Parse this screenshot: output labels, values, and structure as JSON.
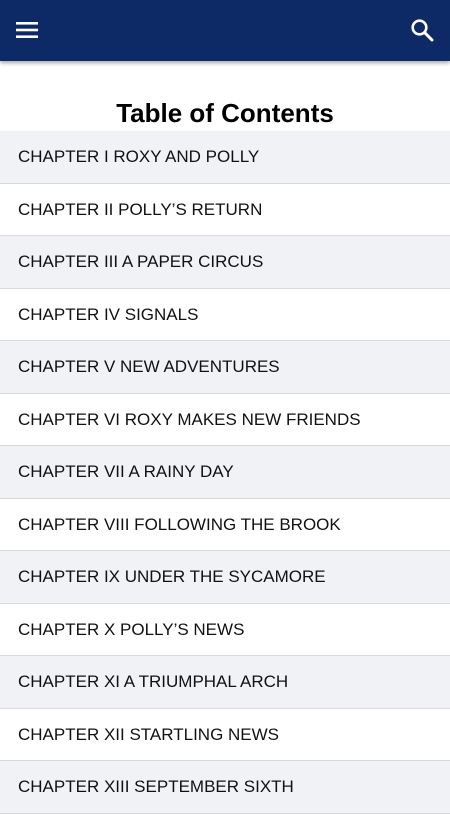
{
  "app_bar": {
    "menu_icon": "hamburger-menu-icon",
    "search_icon": "search-icon",
    "background_color": "#0d2a66"
  },
  "page": {
    "title": "Table of Contents"
  },
  "chapters": [
    {
      "label": "CHAPTER I ROXY AND POLLY"
    },
    {
      "label": "CHAPTER II POLLY’S RETURN"
    },
    {
      "label": "CHAPTER III A PAPER CIRCUS"
    },
    {
      "label": "CHAPTER IV SIGNALS"
    },
    {
      "label": "CHAPTER V NEW ADVENTURES"
    },
    {
      "label": "CHAPTER VI ROXY MAKES NEW FRIENDS"
    },
    {
      "label": "CHAPTER VII A RAINY DAY"
    },
    {
      "label": "CHAPTER VIII FOLLOWING THE BROOK"
    },
    {
      "label": "CHAPTER IX UNDER THE SYCAMORE"
    },
    {
      "label": "CHAPTER X POLLY’S NEWS"
    },
    {
      "label": "CHAPTER XI A TRIUMPHAL ARCH"
    },
    {
      "label": "CHAPTER XII STARTLING NEWS"
    },
    {
      "label": "CHAPTER XIII SEPTEMBER SIXTH"
    }
  ]
}
